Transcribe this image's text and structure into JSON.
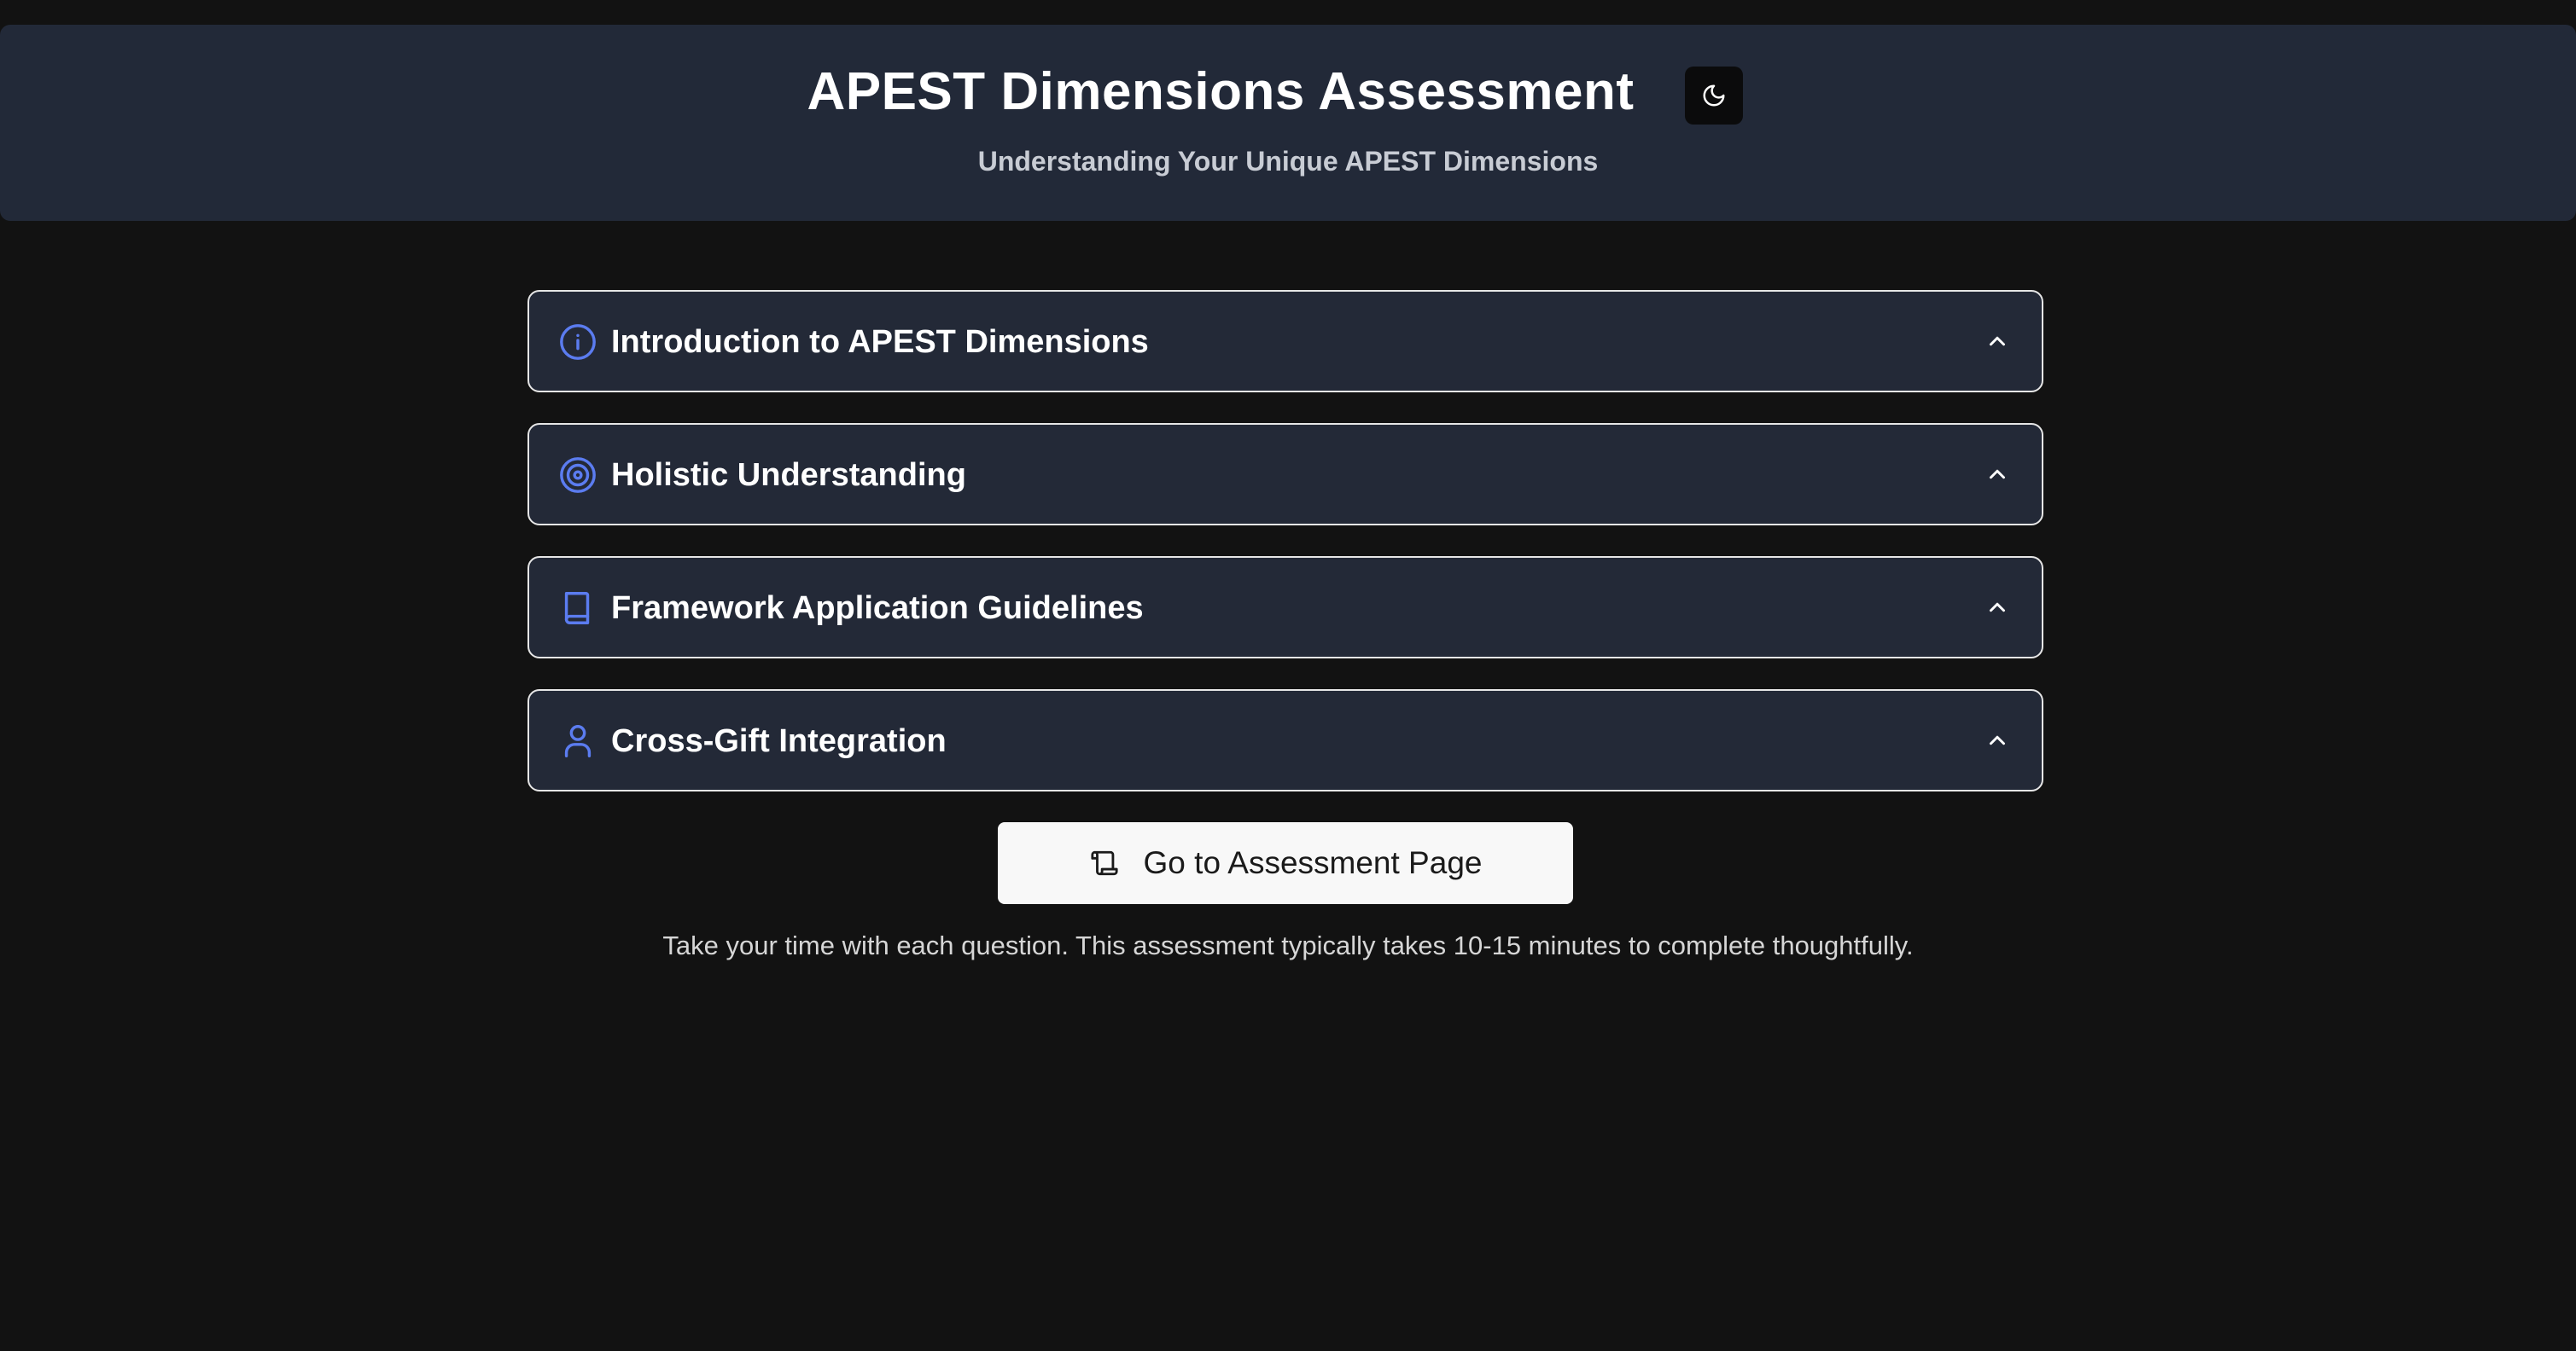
{
  "header": {
    "title": "APEST Dimensions Assessment",
    "subtitle": "Understanding Your Unique APEST Dimensions",
    "theme_toggle_icon": "moon-icon"
  },
  "sections": [
    {
      "label": "Introduction to APEST Dimensions",
      "icon": "info-circle-icon",
      "expanded": false
    },
    {
      "label": "Holistic Understanding",
      "icon": "target-icon",
      "expanded": false
    },
    {
      "label": "Framework Application Guidelines",
      "icon": "book-icon",
      "expanded": false
    },
    {
      "label": "Cross-Gift Integration",
      "icon": "user-icon",
      "expanded": false
    }
  ],
  "cta": {
    "label": "Go to Assessment Page",
    "icon": "scroll-icon"
  },
  "footnote": "Take your time with each question. This assessment typically takes 10-15 minutes to complete thoughtfully.",
  "colors": {
    "background": "#121212",
    "panel": "#232937",
    "accent": "#5b7cf0",
    "text": "#ffffff"
  }
}
